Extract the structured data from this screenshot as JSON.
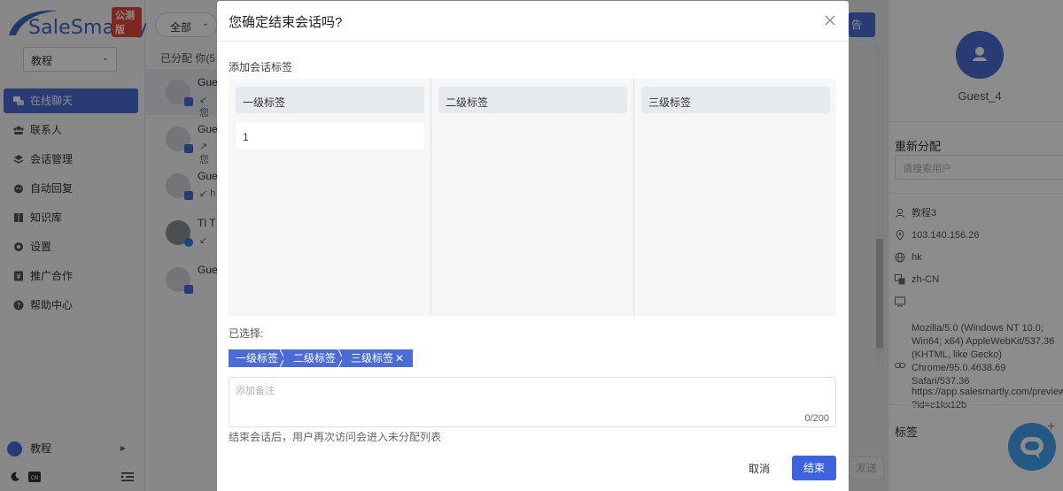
{
  "brand": {
    "name": "SaleSmartly",
    "badge": "公测版"
  },
  "sidebar": {
    "workspace": "教程",
    "items": [
      {
        "label": "在线聊天",
        "icon": "chat-icon",
        "active": true
      },
      {
        "label": "联系人",
        "icon": "contacts-icon"
      },
      {
        "label": "会话管理",
        "icon": "layers-icon"
      },
      {
        "label": "自动回复",
        "icon": "robot-icon"
      },
      {
        "label": "知识库",
        "icon": "book-icon"
      },
      {
        "label": "设置",
        "icon": "gear-icon"
      },
      {
        "label": "推广合作",
        "icon": "money-icon"
      },
      {
        "label": "帮助中心",
        "icon": "help-icon"
      }
    ],
    "user": "教程"
  },
  "conversations": {
    "filter": "全部",
    "tabs": "已分配  你(5",
    "items": [
      {
        "name": "Gue",
        "preview": "↙ 您"
      },
      {
        "name": "Gue",
        "preview": "↗ 您"
      },
      {
        "name": "Gue",
        "preview": "↙ h"
      },
      {
        "name": "Tl T",
        "preview": "↙"
      },
      {
        "name": "Gue",
        "preview": ""
      }
    ]
  },
  "chat": {
    "send_label": "发送",
    "top_button": "告"
  },
  "visitor": {
    "name": "Guest_4",
    "reassign_label": "重新分配",
    "reassign_placeholder": "请搜索用户",
    "workspace": "教程3",
    "ip": "103.140.156.26",
    "region": "hk",
    "language": "zh-CN",
    "user_agent": "Mozilla/5.0 (Windows NT 10.0;\nWin64; x64) AppleWebKit/537.36\n(KHTML, like Gecko)\nChrome/95.0.4638.69 Safari/537.36",
    "url": "https://app.salesmartly.com/preview/\n?id=c1kx12b",
    "tags_label": "标签"
  },
  "modal": {
    "title": "您确定结束会话吗?",
    "section_label": "添加会话标签",
    "columns": [
      {
        "header": "一级标签",
        "options": [
          "1"
        ]
      },
      {
        "header": "二级标签",
        "options": []
      },
      {
        "header": "三级标签",
        "options": []
      }
    ],
    "selected_label": "已选择:",
    "selected_path": [
      "一级标签",
      "二级标签",
      "三级标签"
    ],
    "note_placeholder": "添加备注",
    "note_count": "0/200",
    "hint": "结束会话后，用户再次访问会进入未分配列表",
    "cancel_label": "取消",
    "confirm_label": "结束"
  },
  "colors": {
    "accent": "#4a6cd4",
    "confirm": "#3d63de",
    "overlay": "rgba(0,0,0,0.45)"
  }
}
